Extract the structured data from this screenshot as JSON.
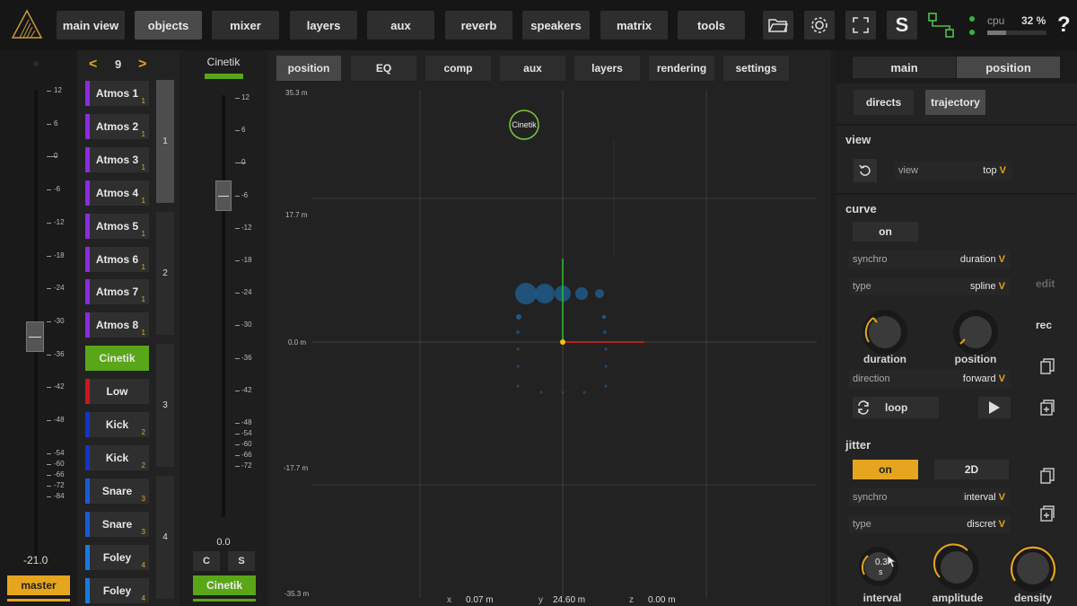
{
  "topbar": {
    "tabs": [
      "main view",
      "objects",
      "mixer",
      "layers",
      "aux",
      "reverb",
      "speakers",
      "matrix",
      "tools"
    ],
    "active_tab": "objects",
    "solo_label": "S",
    "help_label": "?",
    "cpu_label": "cpu",
    "cpu_value": "32 %"
  },
  "master": {
    "scale": [
      "12",
      "6",
      "0",
      "-6",
      "-12",
      "-18",
      "-24",
      "-30",
      "-36",
      "-42",
      "-48",
      "-54",
      "-60",
      "-66",
      "-72",
      "-84"
    ],
    "value": "-21.0",
    "button": "master"
  },
  "objects": {
    "page_prev": "<",
    "page": "9",
    "page_next": ">",
    "items": [
      {
        "label": "Atmos 1",
        "num": "1",
        "color": "#8a2be2"
      },
      {
        "label": "Atmos 2",
        "num": "1",
        "color": "#8a2be2"
      },
      {
        "label": "Atmos 3",
        "num": "1",
        "color": "#8a2be2"
      },
      {
        "label": "Atmos 4",
        "num": "1",
        "color": "#8a2be2"
      },
      {
        "label": "Atmos 5",
        "num": "1",
        "color": "#8a2be2"
      },
      {
        "label": "Atmos 6",
        "num": "1",
        "color": "#8a2be2"
      },
      {
        "label": "Atmos 7",
        "num": "1",
        "color": "#8a2be2"
      },
      {
        "label": "Atmos 8",
        "num": "1",
        "color": "#8a2be2"
      },
      {
        "label": "Cinetik",
        "num": "",
        "color": "#5aa619"
      },
      {
        "label": "Low",
        "num": "",
        "color": "#c8181e"
      },
      {
        "label": "Kick",
        "num": "2",
        "color": "#1434c8"
      },
      {
        "label": "Kick",
        "num": "2",
        "color": "#1434c8"
      },
      {
        "label": "Snare",
        "num": "3",
        "color": "#1a5ad8"
      },
      {
        "label": "Snare",
        "num": "3",
        "color": "#1a5ad8"
      },
      {
        "label": "Foley",
        "num": "4",
        "color": "#1a7ae0"
      },
      {
        "label": "Foley",
        "num": "4",
        "color": "#1a7ae0"
      }
    ],
    "groups": [
      "1",
      "2",
      "3",
      "4"
    ]
  },
  "strip": {
    "name": "Cinetik",
    "scale": [
      "12",
      "6",
      "0",
      "-6",
      "-12",
      "-18",
      "-24",
      "-30",
      "-36",
      "-42",
      "-48",
      "-54",
      "-60",
      "-66",
      "-72"
    ],
    "value": "0.0",
    "c_label": "C",
    "s_label": "S",
    "button": "Cinetik"
  },
  "view": {
    "tabs": [
      "position",
      "EQ",
      "comp",
      "aux",
      "layers",
      "rendering",
      "settings"
    ],
    "active_tab": "position",
    "axis_labels": [
      "35.3 m",
      "17.7 m",
      "0.0 m",
      "-17.7 m",
      "-35.3 m"
    ],
    "object_label": "Cinetik",
    "coords": {
      "x_label": "x",
      "x_value": "0.07 m",
      "y_label": "y",
      "y_value": "24.60 m",
      "z_label": "z",
      "z_value": "0.00 m"
    }
  },
  "right": {
    "tabs": [
      "main",
      "position"
    ],
    "subtabs": [
      "directs",
      "trajectory"
    ],
    "view_section": {
      "title": "view",
      "row_key": "view",
      "row_value": "top"
    },
    "curve": {
      "title": "curve",
      "on": "on",
      "synchro_key": "synchro",
      "synchro_value": "duration",
      "type_key": "type",
      "type_value": "spline",
      "edit": "edit",
      "rec": "rec",
      "duration_label": "duration",
      "position_label": "position",
      "direction_key": "direction",
      "direction_value": "forward",
      "loop": "loop"
    },
    "jitter": {
      "title": "jitter",
      "on": "on",
      "mode": "2D",
      "synchro_key": "synchro",
      "synchro_value": "interval",
      "type_key": "type",
      "type_value": "discret",
      "interval_value": "0.3",
      "interval_unit": "s",
      "interval_label": "interval",
      "amplitude_label": "amplitude",
      "density_label": "density"
    },
    "chevron": "V"
  },
  "colors": {
    "accent": "#e6a51e",
    "green": "#5aa619"
  }
}
